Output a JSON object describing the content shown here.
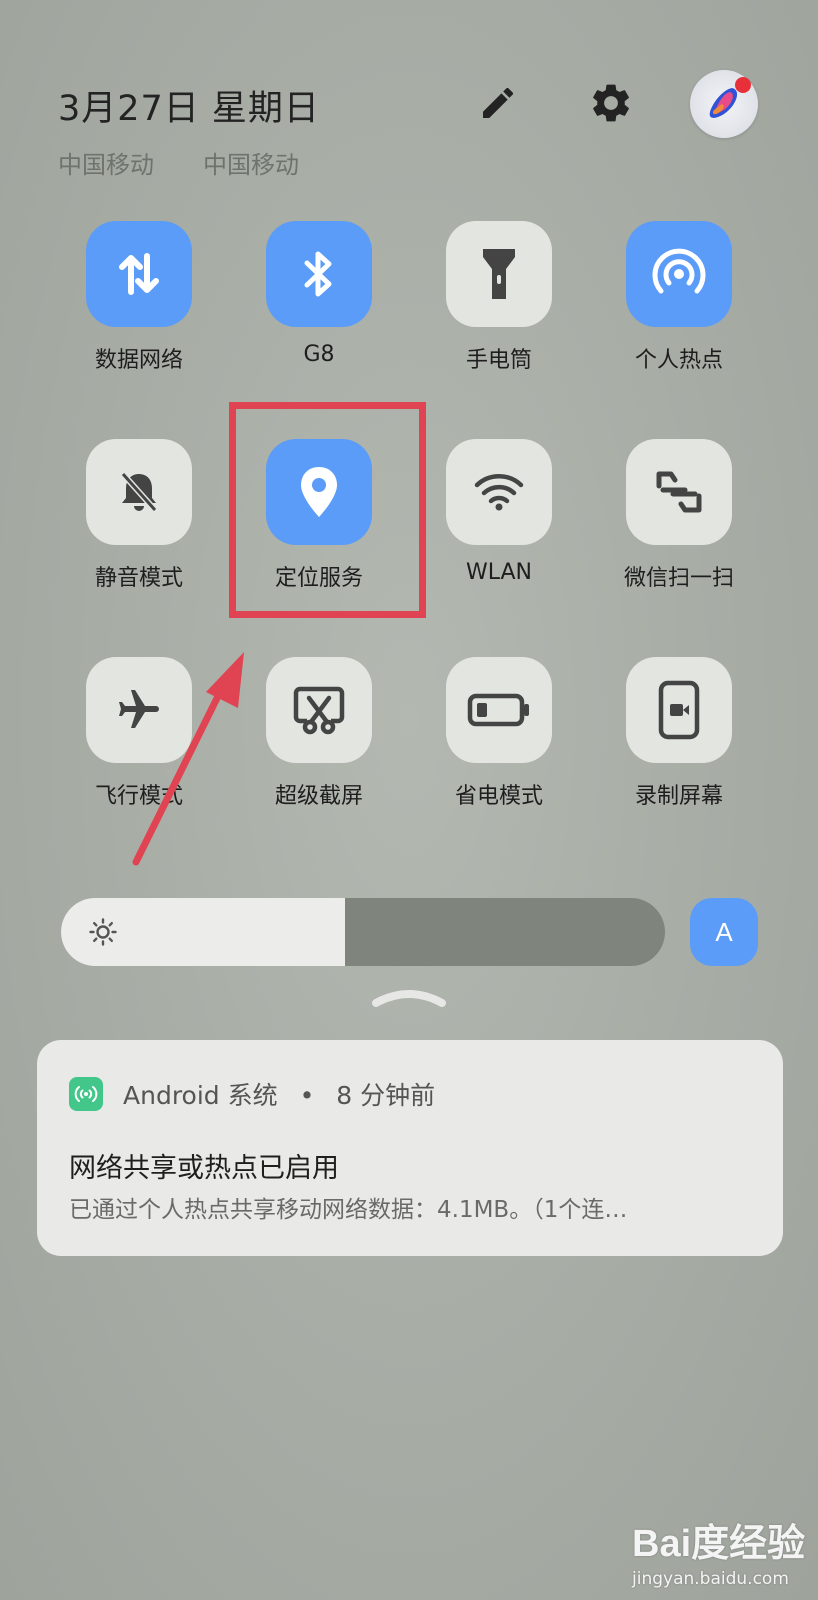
{
  "header": {
    "date": "3月27日  星期日",
    "carriers": [
      "中国移动",
      "中国移动"
    ],
    "icons": [
      "edit-pencil-icon",
      "settings-gear-icon",
      "account-avatar-icon"
    ]
  },
  "tiles": [
    {
      "label": "数据网络",
      "icon": "data-arrows-icon",
      "active": true
    },
    {
      "label": "G8",
      "icon": "bluetooth-icon",
      "active": true
    },
    {
      "label": "手电筒",
      "icon": "flashlight-icon",
      "active": false
    },
    {
      "label": "个人热点",
      "icon": "hotspot-icon",
      "active": true
    },
    {
      "label": "静音模式",
      "icon": "bell-off-icon",
      "active": false
    },
    {
      "label": "定位服务",
      "icon": "location-pin-icon",
      "active": true
    },
    {
      "label": "WLAN",
      "icon": "wifi-icon",
      "active": false
    },
    {
      "label": "微信扫一扫",
      "icon": "scan-icon",
      "active": false
    },
    {
      "label": "飞行模式",
      "icon": "airplane-icon",
      "active": false
    },
    {
      "label": "超级截屏",
      "icon": "screenshot-scissors-icon",
      "active": false
    },
    {
      "label": "省电模式",
      "icon": "battery-icon",
      "active": false
    },
    {
      "label": "录制屏幕",
      "icon": "screen-record-icon",
      "active": false
    }
  ],
  "brightness": {
    "level": 0.47,
    "icon": "sun-icon",
    "auto_label": "A"
  },
  "notification": {
    "app": "Android 系统",
    "separator": "•",
    "time": "8 分钟前",
    "title": "网络共享或热点已启用",
    "body": "已通过个人热点共享移动网络数据：4.1MB。（1个连…"
  },
  "colors": {
    "accent": "#5b9cf8",
    "annotation": "#e04452",
    "notification_icon": "#43c68a"
  },
  "watermark": {
    "logo": "Bai度经验",
    "url": "jingyan.baidu.com"
  }
}
